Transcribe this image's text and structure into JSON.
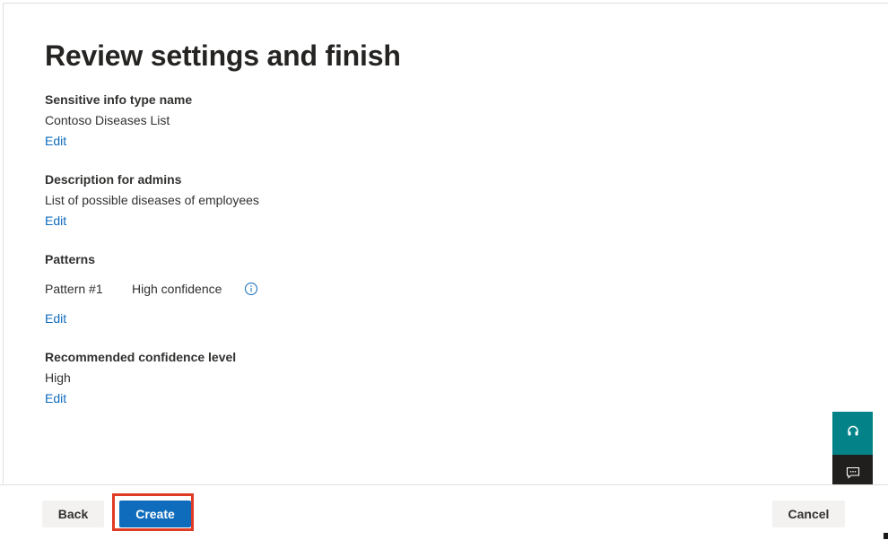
{
  "page": {
    "title": "Review settings and finish"
  },
  "sections": {
    "name": {
      "label": "Sensitive info type name",
      "value": "Contoso Diseases List",
      "edit_label": "Edit"
    },
    "description": {
      "label": "Description for admins",
      "value": "List of possible diseases of employees",
      "edit_label": "Edit"
    },
    "patterns": {
      "label": "Patterns",
      "items": [
        {
          "name": "Pattern #1",
          "confidence": "High confidence",
          "icon": "info-icon"
        }
      ],
      "edit_label": "Edit"
    },
    "confidence": {
      "label": "Recommended confidence level",
      "value": "High",
      "edit_label": "Edit"
    }
  },
  "footer": {
    "back_label": "Back",
    "create_label": "Create",
    "cancel_label": "Cancel"
  },
  "floating": {
    "help_icon": "headset-icon",
    "feedback_icon": "feedback-chat-icon"
  },
  "colors": {
    "accent": "#0f6cbd",
    "help_bg": "#038387",
    "feedback_bg": "#201f1e",
    "highlight": "#e03b24",
    "secondary_button_bg": "#f3f2f1"
  }
}
